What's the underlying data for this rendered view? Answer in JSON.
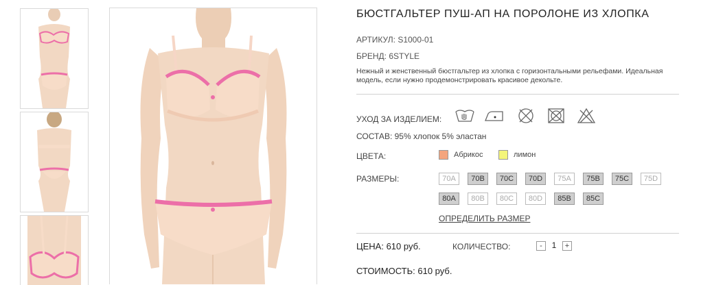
{
  "product": {
    "title": "БЮСТГАЛЬТЕР ПУШ-АП НА ПОРОЛОНЕ ИЗ ХЛОПКА",
    "article": "АРТИКУЛ: S1000-01",
    "brand": "БРЕНД: 6STYLE",
    "description": "Нежный и женственный бюстгальтер из хлопка с горизонтальными рельефами. Идеальная модель, если нужно продемонстрировать красивое декольте."
  },
  "care": {
    "label": "УХОД ЗА ИЗДЕЛИЕМ:",
    "icons": [
      "hand-wash-icon",
      "iron-low-icon",
      "no-tumble-dry-icon",
      "no-machine-dry-icon",
      "no-bleach-icon"
    ]
  },
  "composition": "СОСТАВ: 95% хлопок 5% эластан",
  "colors": {
    "label": "ЦВЕТА:",
    "options": [
      {
        "name": "Абрикос",
        "hex": "#f4a57e"
      },
      {
        "name": "лимон",
        "hex": "#f4f57a"
      }
    ]
  },
  "sizes": {
    "label": "РАЗМЕРЫ:",
    "row1": [
      {
        "label": "70A",
        "available": false
      },
      {
        "label": "70B",
        "available": true
      },
      {
        "label": "70C",
        "available": true
      },
      {
        "label": "70D",
        "available": true
      },
      {
        "label": "75A",
        "available": false
      },
      {
        "label": "75B",
        "available": true
      },
      {
        "label": "75C",
        "available": true
      },
      {
        "label": "75D",
        "available": false
      }
    ],
    "row2": [
      {
        "label": "80A",
        "available": true
      },
      {
        "label": "80B",
        "available": false
      },
      {
        "label": "80C",
        "available": false
      },
      {
        "label": "80D",
        "available": false
      },
      {
        "label": "85B",
        "available": true
      },
      {
        "label": "85C",
        "available": true
      }
    ],
    "size_guide_link": "ОПРЕДЕЛИТЬ РАЗМЕР"
  },
  "order": {
    "price": "ЦЕНА: 610 руб.",
    "quantity_label": "КОЛИЧЕСТВО:",
    "minus": "-",
    "quantity": "1",
    "plus": "+",
    "total": "СТОИМОСТЬ: 610 руб."
  },
  "colors_ui": {
    "skin": "#f2d8c3",
    "fabric": "#f7dcc8",
    "pink": "#ec6fa8",
    "available_size_bg": "#cfcfcf"
  }
}
